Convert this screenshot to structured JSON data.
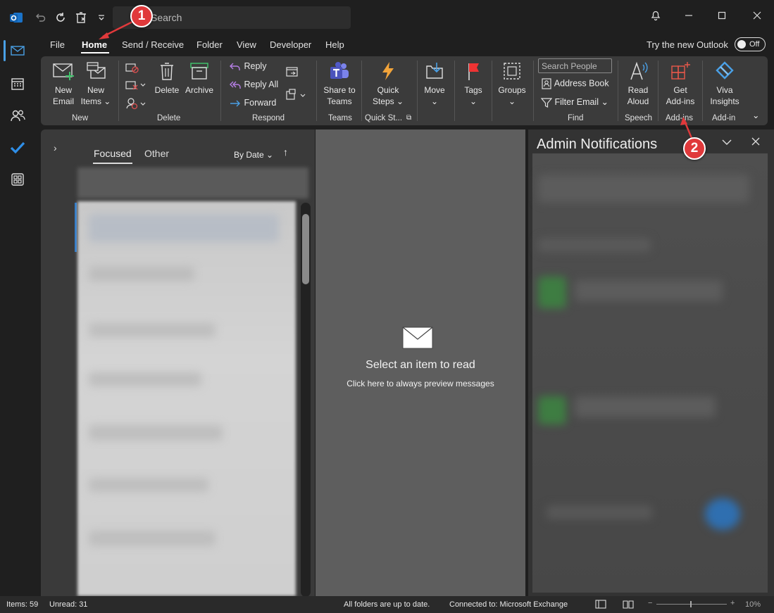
{
  "titlebar": {
    "search_placeholder": "Search"
  },
  "menu": {
    "tabs": [
      "File",
      "Home",
      "Send / Receive",
      "Folder",
      "View",
      "Developer",
      "Help"
    ],
    "try_new": "Try the new Outlook",
    "toggle_label": "Off"
  },
  "ribbon": {
    "new_email": [
      "New",
      "Email"
    ],
    "new_items": [
      "New",
      "Items"
    ],
    "delete": "Delete",
    "archive": "Archive",
    "reply": "Reply",
    "reply_all": "Reply All",
    "forward": "Forward",
    "share_teams": [
      "Share to",
      "Teams"
    ],
    "quick_steps": [
      "Quick",
      "Steps"
    ],
    "move": "Move",
    "tags": "Tags",
    "groups": "Groups",
    "search_people": "Search People",
    "address_book": "Address Book",
    "filter_email": "Filter Email",
    "read_aloud": [
      "Read",
      "Aloud"
    ],
    "get_addins": [
      "Get",
      "Add-ins"
    ],
    "viva": [
      "Viva",
      "Insights"
    ],
    "groups_labels": [
      "New",
      "Delete",
      "Respond",
      "Teams",
      "Quick St...",
      "Find",
      "Speech",
      "Add-ins",
      "Add-in"
    ]
  },
  "list": {
    "focused": "Focused",
    "other": "Other",
    "sort": "By Date"
  },
  "reading": {
    "title": "Select an item to read",
    "hint": "Click here to always preview messages"
  },
  "admin": {
    "title": "Admin Notifications"
  },
  "status": {
    "items": "Items: 59",
    "unread": "Unread: 31",
    "sync": "All folders are up to date.",
    "connected": "Connected to: Microsoft Exchange",
    "zoom": "10%"
  },
  "annotations": [
    "1",
    "2"
  ],
  "colors": {
    "accent": "#4aa0e6",
    "badge": "#e0393b"
  }
}
